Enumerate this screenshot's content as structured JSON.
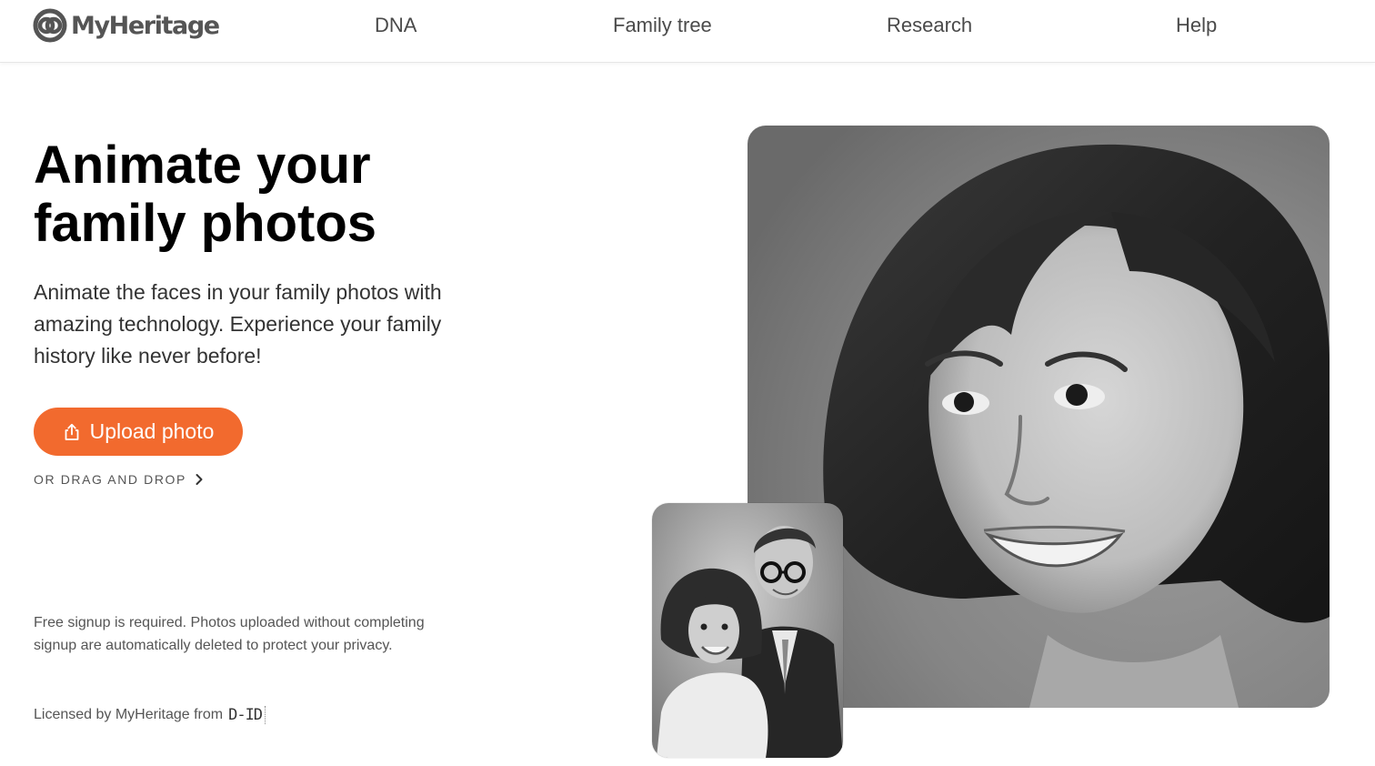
{
  "header": {
    "logo_text": "MyHeritage",
    "nav": [
      {
        "label": "DNA"
      },
      {
        "label": "Family tree"
      },
      {
        "label": "Research"
      },
      {
        "label": "Help"
      }
    ]
  },
  "hero": {
    "title_line1": "Animate your",
    "title_line2": "family photos",
    "description": "Animate the faces in your family photos with amazing technology. Experience your family history like never before!",
    "upload_label": "Upload photo",
    "upload_icon": "upload-icon",
    "drag_drop_label": "OR DRAG AND DROP",
    "drag_drop_icon": "chevron-right-icon"
  },
  "footer_note": {
    "signup_text": "Free signup is required. Photos uploaded without completing signup are automatically deleted to protect your privacy.",
    "licensed_text": "Licensed by MyHeritage from",
    "partner_logo": "D-ID"
  },
  "images": {
    "main": "black-and-white portrait of smiling woman",
    "thumbnail": "black-and-white photo of couple"
  },
  "colors": {
    "accent": "#f26a2e",
    "title": "#000000",
    "body_text": "#333333",
    "nav_text": "#4a4a4a"
  }
}
